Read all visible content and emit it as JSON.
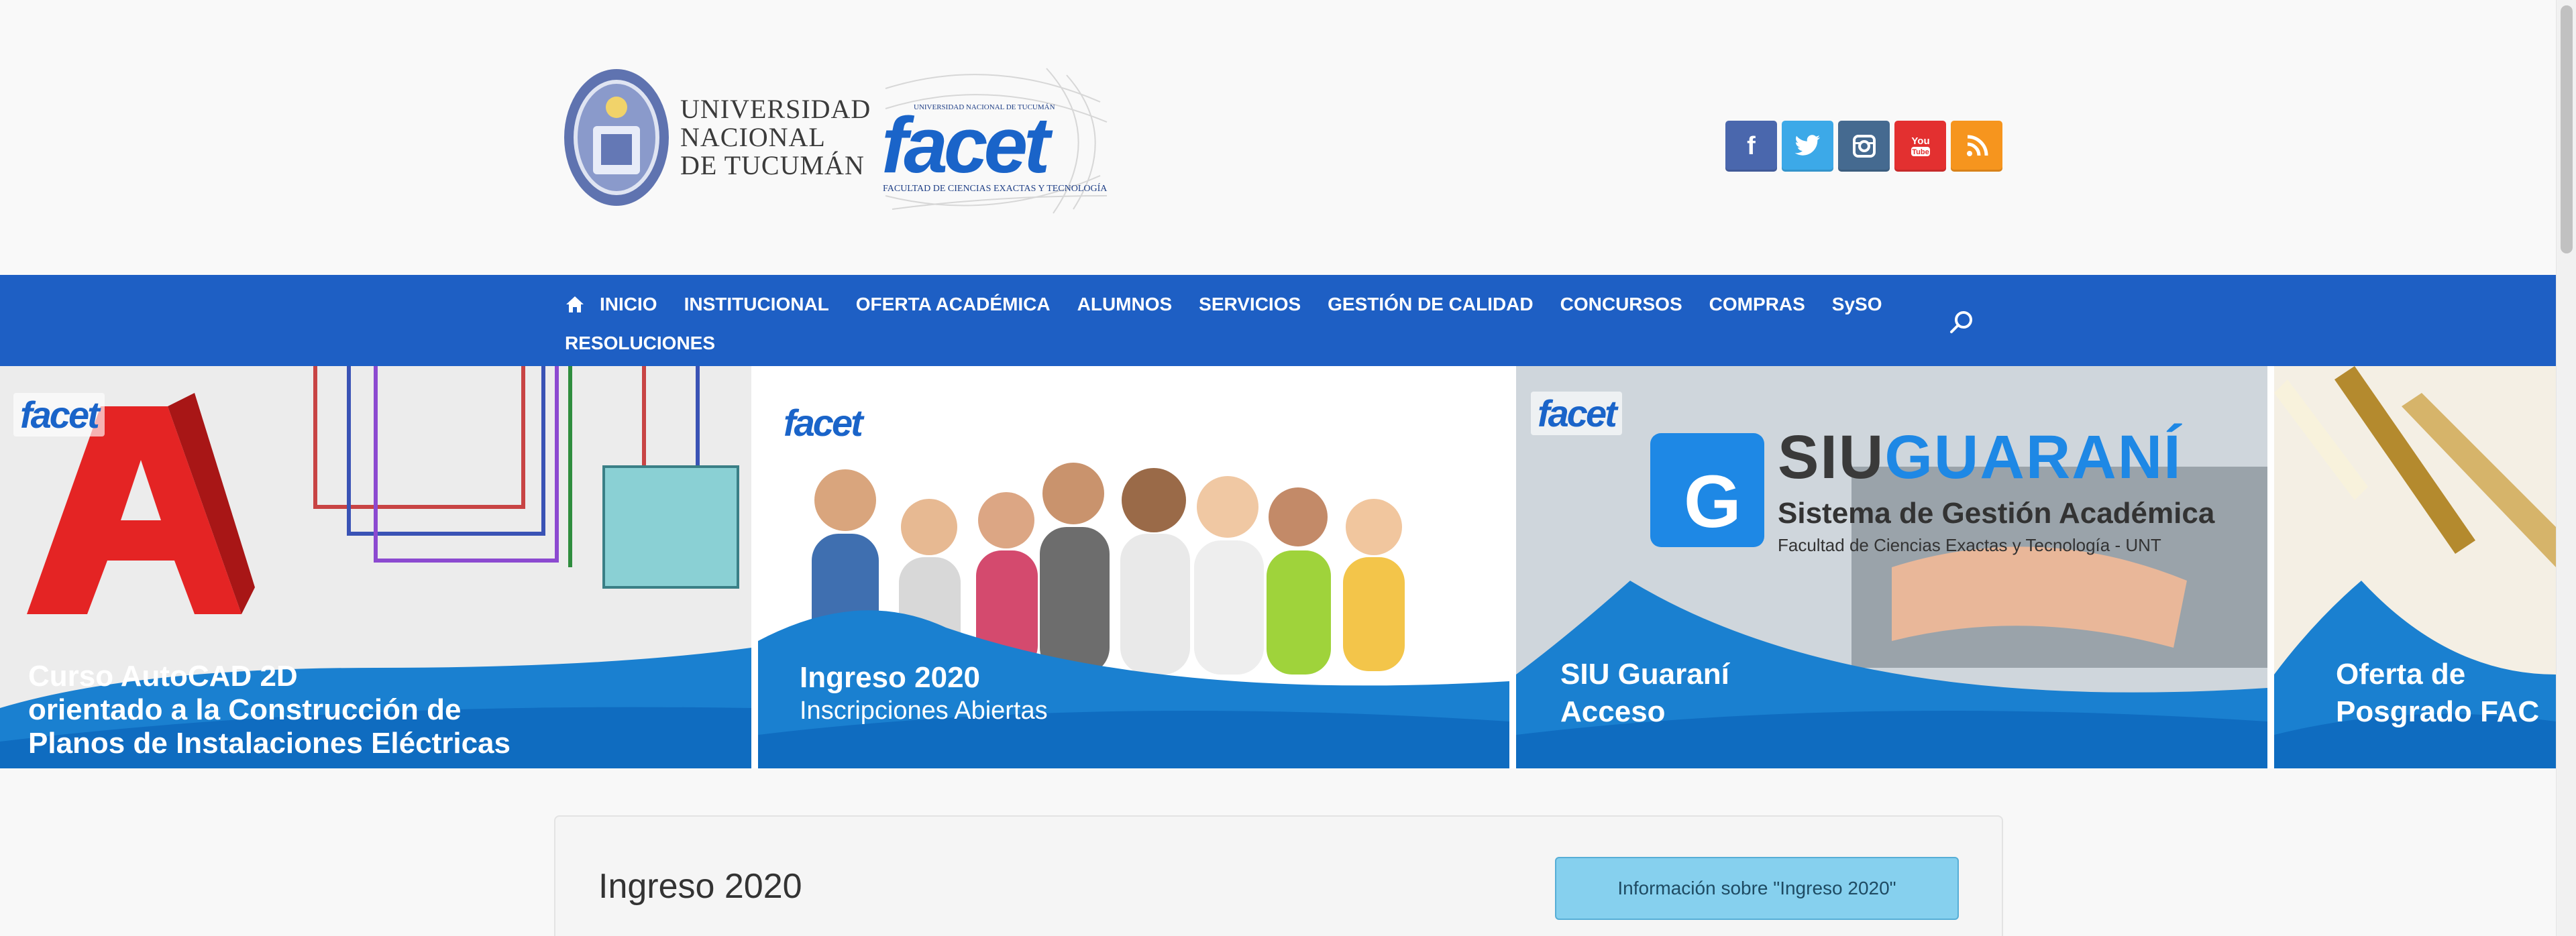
{
  "header": {
    "university_lines": [
      "UNIVERSIDAD",
      "NACIONAL",
      "DE TUCUMÁN"
    ],
    "facet": {
      "top_text": "UNIVERSIDAD NACIONAL DE TUCUMÁN",
      "word": "facet",
      "subtitle": "FACULTAD DE CIENCIAS EXACTAS Y TECNOLOGÍA"
    },
    "social": [
      {
        "name": "facebook",
        "glyph": "f",
        "color": "#4a67ad"
      },
      {
        "name": "twitter",
        "glyph": "🐦",
        "color": "#3ca9e8"
      },
      {
        "name": "instagram",
        "glyph": "◎",
        "color": "#456a90"
      },
      {
        "name": "youtube",
        "glyph": "▶",
        "color": "#e33030"
      },
      {
        "name": "rss",
        "glyph": "◔",
        "color": "#f6951e"
      }
    ]
  },
  "nav": {
    "items_row1": [
      "INICIO",
      "INSTITUCIONAL",
      "OFERTA ACADÉMICA",
      "ALUMNOS",
      "SERVICIOS",
      "GESTIÓN DE CALIDAD",
      "CONCURSOS",
      "COMPRAS",
      "SySO"
    ],
    "items_row2": [
      "RESOLUCIONES"
    ],
    "accent": "#1e5fc4"
  },
  "slides": [
    {
      "lines": [
        "Curso AutoCAD 2D",
        "orientado a la Construcción de",
        "Planos de Instalaciones Eléctricas"
      ],
      "logo": "facet"
    },
    {
      "title": "Ingreso 2020",
      "subtitle": "Inscripciones Abiertas",
      "logo": "facet"
    },
    {
      "lines": [
        "SIU Guaraní",
        "Acceso"
      ],
      "brand_a": "SIU",
      "brand_b": "GUARANÍ",
      "brand_line2": "Sistema de Gestión Académica",
      "brand_line3": "Facultad de Ciencias Exactas y Tecnología - UNT",
      "logo": "facet"
    },
    {
      "lines": [
        "Oferta de",
        "Posgrado FAC"
      ]
    }
  ],
  "card": {
    "title": "Ingreso 2020",
    "button": "Información sobre \"Ingreso 2020\""
  }
}
